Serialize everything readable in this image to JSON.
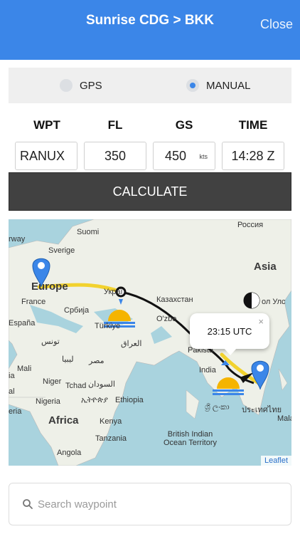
{
  "header": {
    "title": "Sunrise CDG > BKK",
    "close_label": "Close"
  },
  "mode": {
    "gps_label": "GPS",
    "manual_label": "MANUAL",
    "selected": "manual"
  },
  "columns": {
    "wpt": "WPT",
    "fl": "FL",
    "gs": "GS",
    "time": "TIME"
  },
  "inputs": {
    "wpt": "RANUX",
    "fl": "350",
    "gs": "450",
    "gs_unit": "kts",
    "time": "14:28 Z"
  },
  "calculate_label": "CALCULATE",
  "map": {
    "labels": {
      "russia": "Россия",
      "suomi": "Suomi",
      "norway": "rway",
      "sverige": "Sverige",
      "asia": "Asia",
      "europe": "Europe",
      "ukraine": "Украї",
      "kazakhstan": "Казахстан",
      "france": "France",
      "serbia": "Србија",
      "espana": "España",
      "turkey": "Türkiye",
      "uzbekistan": "O'zbe",
      "mongolia": "ол Улс",
      "tunisia": "تونس",
      "iraq": "العراق",
      "libya": "ليبيا",
      "egypt": "مصر",
      "pakistan": "Pakista",
      "mali": "Mali",
      "niger": "Niger",
      "chad": "Tchad",
      "sudan": "السودان",
      "india": "India",
      "nigeria": "Nigeria",
      "ethiopia_am": "ኢትዮጵያ",
      "ethiopia": "Ethiopia",
      "thailand": "ประเทศไทย",
      "africa": "Africa",
      "kenya": "Kenya",
      "tanzania": "Tanzania",
      "angola": "Angola",
      "malaysia": "Malay",
      "sri_lanka": "ශ්‍රී ලංකා",
      "biot": "British Indian\nOcean Territory",
      "ia": "ia",
      "al": "al",
      "eria": "eria"
    },
    "popup_time": "23:15 UTC",
    "popup_close": "×",
    "attribution": "Leaflet"
  },
  "search": {
    "placeholder": "Search waypoint"
  },
  "colors": {
    "accent": "#3b86e8",
    "route": "#111111",
    "daylight": "#f2d22e",
    "water": "#a9d3de",
    "land": "#eef0e8"
  }
}
